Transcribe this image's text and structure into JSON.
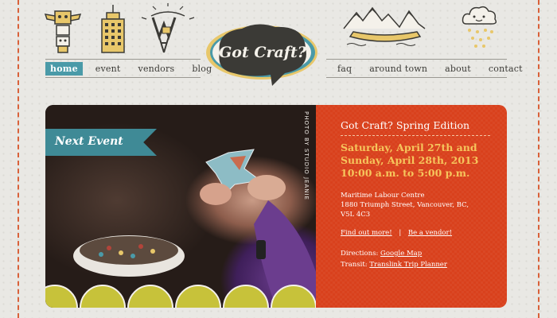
{
  "nav": {
    "left": [
      {
        "label": "home",
        "active": true
      },
      {
        "label": "event",
        "active": false
      },
      {
        "label": "vendors",
        "active": false
      },
      {
        "label": "blog",
        "active": false
      }
    ],
    "right": [
      {
        "label": "faq"
      },
      {
        "label": "around town"
      },
      {
        "label": "about"
      },
      {
        "label": "contact"
      }
    ]
  },
  "logo": {
    "text": "Got Craft?"
  },
  "hero": {
    "banner": "Next Event",
    "photo_credit": "PHOTO BY STUDIO JEANIE",
    "event_title": "Got Craft? Spring Edition",
    "date_line1": "Saturday, April 27th and",
    "date_line2": "Sunday, April 28th, 2013",
    "time": "10:00 a.m. to 5:00 p.m.",
    "venue_name": "Maritime Labour Centre",
    "venue_address1": "1880 Triumph Street, Vancouver, BC,",
    "venue_address2": "V5L 4C3",
    "link_find_out": "Find out more!",
    "link_separator": "|",
    "link_vendor": "Be a vendor!",
    "directions_label": "Directions:",
    "directions_link": "Google Map",
    "transit_label": "Transit:",
    "transit_link": "Translink Trip Planner"
  },
  "colors": {
    "accent_teal": "#4a9aa8",
    "info_orange": "#d9411d",
    "date_yellow": "#f6c55c",
    "stitch": "#d9613a"
  },
  "icons": [
    "totem-icon",
    "building-icon",
    "tower-icon",
    "mountains-canoe-icon",
    "cloud-rain-icon"
  ]
}
